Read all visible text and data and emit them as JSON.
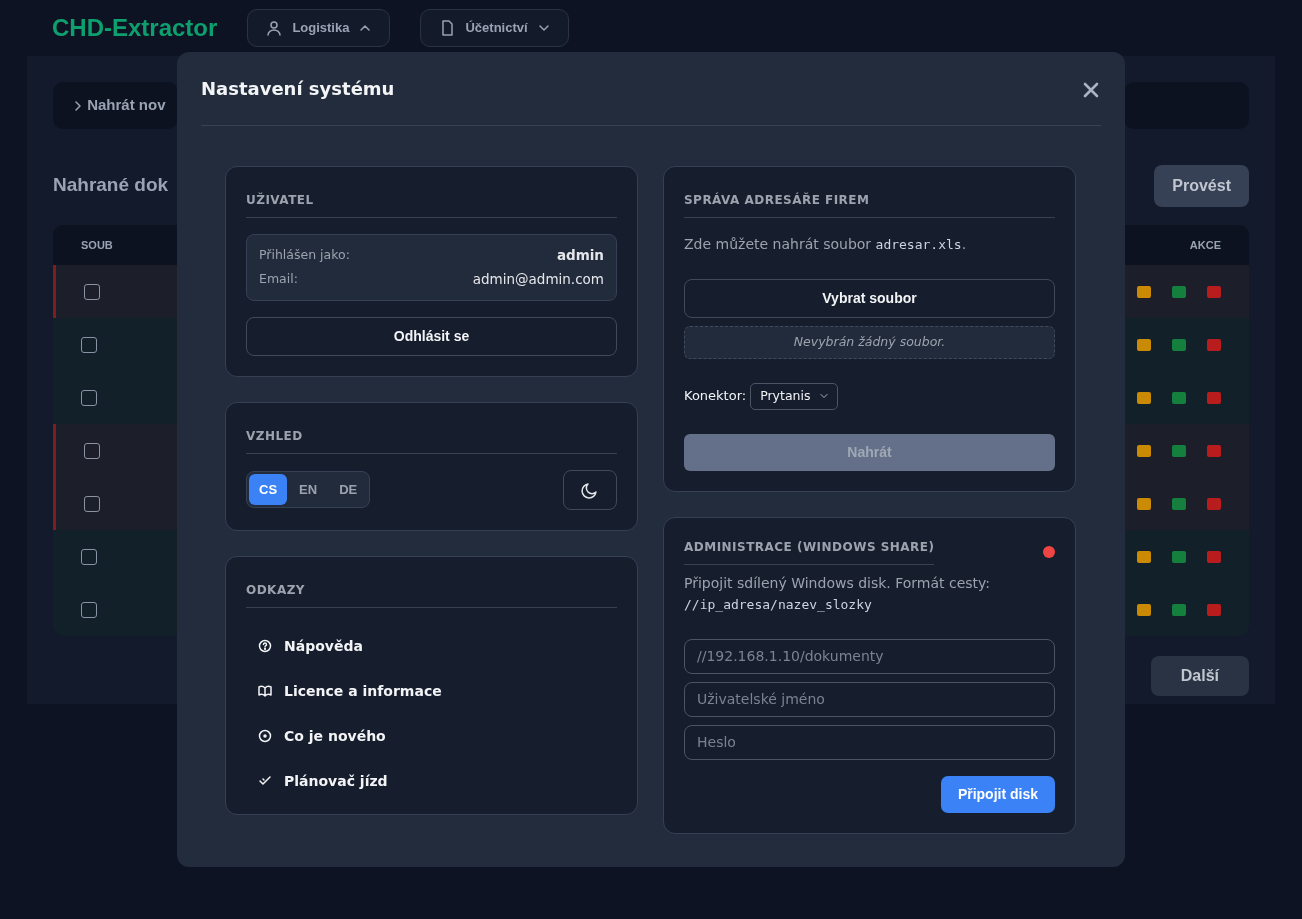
{
  "app": {
    "logo": "CHD-Extractor",
    "nav": [
      {
        "label": "Logistika",
        "expanded": true
      },
      {
        "label": "Účetnictví",
        "expanded": false
      }
    ],
    "upload_panel": "Nahrát nov",
    "section_title": "Nahrané dok",
    "submit": "Provést",
    "table": {
      "columns": [
        "SOUB",
        "AKCE"
      ],
      "rows": [
        {
          "warning": true
        },
        {
          "warning": false
        },
        {
          "warning": false
        },
        {
          "warning": true
        },
        {
          "warning": true
        },
        {
          "warning": false
        },
        {
          "warning": false
        }
      ]
    },
    "next": "Další"
  },
  "modal": {
    "title": "Nastavení systému",
    "user": {
      "heading": "UŽIVATEL",
      "rows": [
        {
          "label": "Přihlášen jako:",
          "value": "admin",
          "bold": true
        },
        {
          "label": "Email:",
          "value": "admin@admin.com",
          "bold": false
        }
      ],
      "logout": "Odhlásit se"
    },
    "appearance": {
      "heading": "VZHLED",
      "languages": [
        {
          "label": "CS",
          "selected": true
        },
        {
          "label": "EN",
          "selected": false
        },
        {
          "label": "DE",
          "selected": false
        }
      ],
      "dark_mode": true
    },
    "links": {
      "heading": "ODKAZY",
      "items": [
        {
          "label": "Nápověda",
          "kind": "help"
        },
        {
          "label": "Licence a informace",
          "kind": "book"
        },
        {
          "label": "Co je nového",
          "kind": "news"
        },
        {
          "label": "Plánovač jízd",
          "kind": "planner"
        }
      ]
    },
    "directory": {
      "heading": "SPRÁVA ADRESÁŘE FIREM",
      "text": "Zde můžete nahrát soubor ",
      "code": "adresar.xls",
      "text_end": ".",
      "choose": "Vybrat soubor",
      "no_file": "Nevybrán žádný soubor.",
      "connector_label": "Konektor:",
      "connector": "Prytanis",
      "upload": "Nahrát",
      "upload_disabled": true
    },
    "share": {
      "heading": "ADMINISTRACE (WINDOWS SHARE)",
      "connected": false,
      "text": "Připojit sdílený Windows disk. Formát cesty:",
      "code": "//ip_adresa/nazev_slozky",
      "fields": [
        {
          "placeholder": "//192.168.1.10/dokumenty"
        },
        {
          "placeholder": "Uživatelské jméno"
        },
        {
          "placeholder": "Heslo"
        }
      ],
      "button": "Připojit disk"
    }
  }
}
